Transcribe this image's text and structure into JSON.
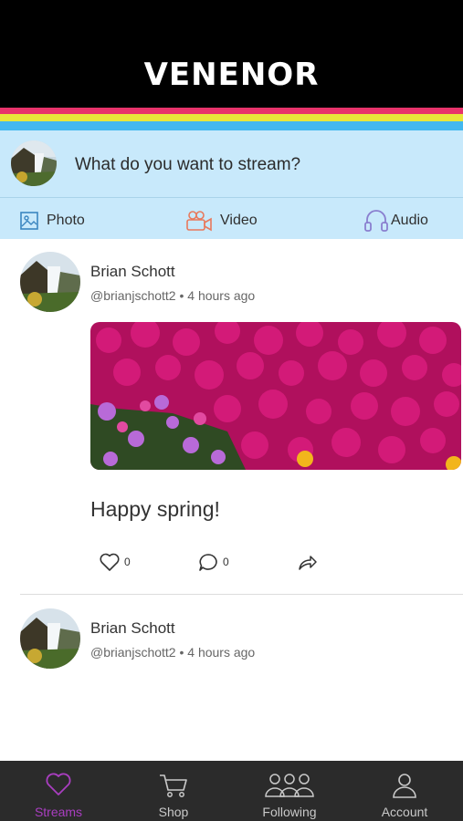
{
  "app": {
    "logo_text": "VENENOR"
  },
  "colors": {
    "stripe_pink": "#e8336b",
    "stripe_yellow": "#e8e63a",
    "stripe_blue": "#43b8ef",
    "compose_bg": "#c8e9fb",
    "active_tab": "#a93ec0",
    "tabbar_bg": "#2b2b2b"
  },
  "compose": {
    "prompt": "What do you want to stream?",
    "options": [
      {
        "label": "Photo",
        "icon": "image-icon"
      },
      {
        "label": "Video",
        "icon": "video-camera-icon"
      },
      {
        "label": "Audio",
        "icon": "headphones-icon"
      }
    ]
  },
  "posts": [
    {
      "author": "Brian Schott",
      "handle": "@brianjschott2",
      "time": "4 hours ago",
      "meta": "@brianjschott2 • 4 hours ago",
      "text": "Happy spring!",
      "likes": "0",
      "comments": "0"
    },
    {
      "author": "Brian Schott",
      "handle": "@brianjschott2",
      "time": "4 hours ago",
      "meta": "@brianjschott2 • 4 hours ago"
    }
  ],
  "tabs": [
    {
      "label": "Streams",
      "icon": "heart-icon",
      "active": true
    },
    {
      "label": "Shop",
      "icon": "cart-icon",
      "active": false
    },
    {
      "label": "Following",
      "icon": "group-icon",
      "active": false
    },
    {
      "label": "Account",
      "icon": "person-icon",
      "active": false
    }
  ]
}
